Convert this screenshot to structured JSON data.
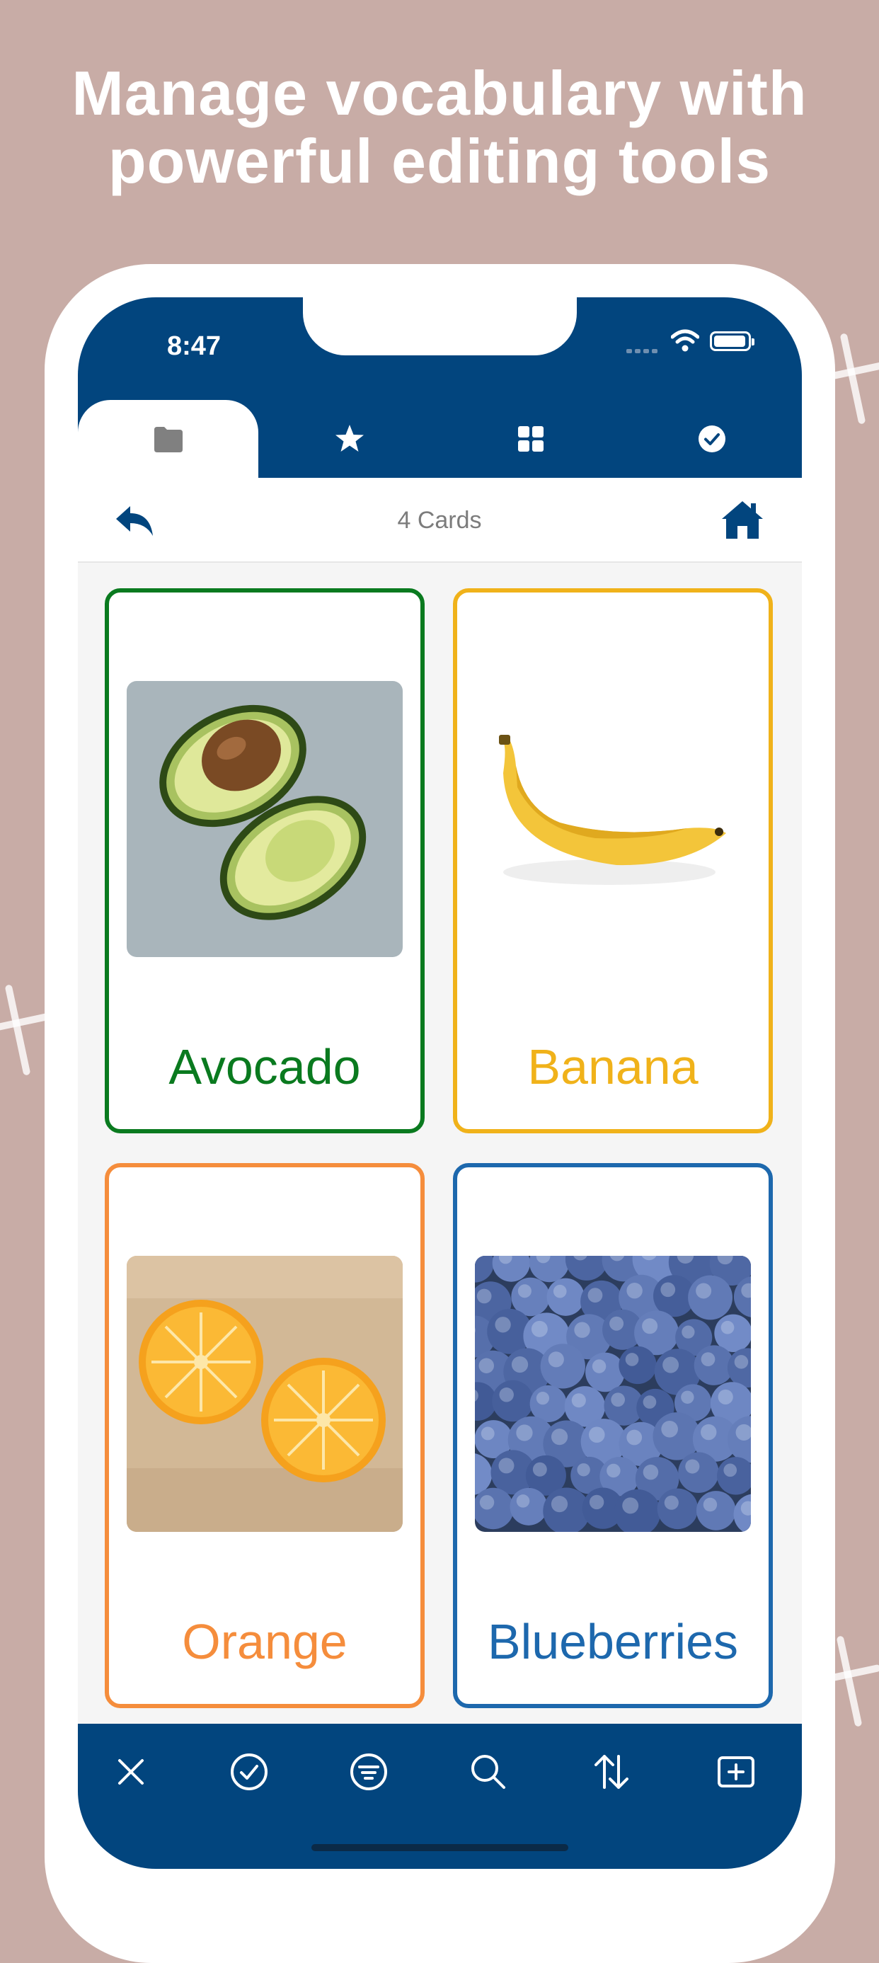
{
  "headline": {
    "line1": "Manage vocabulary with",
    "line2": "powerful editing tools"
  },
  "status_bar": {
    "time": "8:47"
  },
  "tabs": [
    {
      "name": "folder-tab",
      "icon": "folder-icon",
      "active": true
    },
    {
      "name": "favorites-tab",
      "icon": "star-icon",
      "active": false
    },
    {
      "name": "grid-tab",
      "icon": "grid-icon",
      "active": false
    },
    {
      "name": "quiz-tab",
      "icon": "checkmark-circle-icon",
      "active": false
    }
  ],
  "nav": {
    "title": "4 Cards",
    "back_icon": "back-arrow-icon",
    "home_icon": "home-icon"
  },
  "cards": [
    {
      "label": "Avocado",
      "color": "#0a7a1f",
      "image": "avocado-photo"
    },
    {
      "label": "Banana",
      "color": "#f0b21a",
      "image": "banana-photo"
    },
    {
      "label": "Orange",
      "color": "#f58d3c",
      "image": "orange-photo"
    },
    {
      "label": "Blueberries",
      "color": "#1d68ad",
      "image": "blueberries-photo"
    }
  ],
  "toolbar": [
    {
      "name": "close-button",
      "icon": "close-icon"
    },
    {
      "name": "select-button",
      "icon": "checkmark-circle-icon"
    },
    {
      "name": "filter-button",
      "icon": "filter-icon"
    },
    {
      "name": "search-button",
      "icon": "search-icon"
    },
    {
      "name": "sort-button",
      "icon": "sort-icon"
    },
    {
      "name": "add-card-button",
      "icon": "add-square-icon"
    }
  ],
  "colors": {
    "background": "#c8aca6",
    "brand_blue": "#02457e",
    "screen_bg": "#f5f5f5"
  }
}
